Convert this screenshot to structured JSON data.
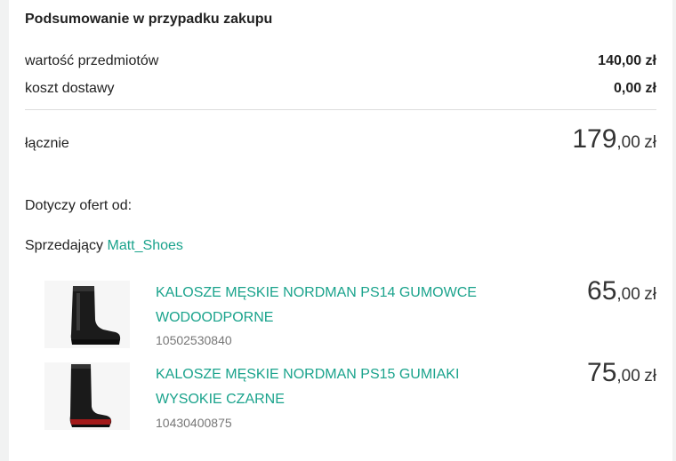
{
  "summary": {
    "title": "Podsumowanie w przypadku zakupu",
    "items_value_label": "wartość przedmiotów",
    "items_value": "140,00 zł",
    "shipping_label": "koszt dostawy",
    "shipping_value": "0,00 zł",
    "total_label": "łącznie",
    "total_int": "179",
    "total_dec": ",00",
    "total_currency": "zł"
  },
  "offers_section": {
    "applies_label": "Dotyczy ofert od:",
    "seller_prefix": "Sprzedający",
    "seller_name": "Matt_Shoes"
  },
  "offers": [
    {
      "title": "KALOSZE MĘSKIE NORDMAN PS14 GUMOWCE WODOODPORNE",
      "id": "10502530840",
      "price_int": "65",
      "price_dec": ",00",
      "currency": "zł"
    },
    {
      "title": "KALOSZE MĘSKIE NORDMAN PS15 GUMIAKI WYSOKIE CZARNE",
      "id": "10430400875",
      "price_int": "75",
      "price_dec": ",00",
      "currency": "zł"
    }
  ],
  "colors": {
    "accent": "#1aa38c",
    "background": "#f1f2f2"
  }
}
